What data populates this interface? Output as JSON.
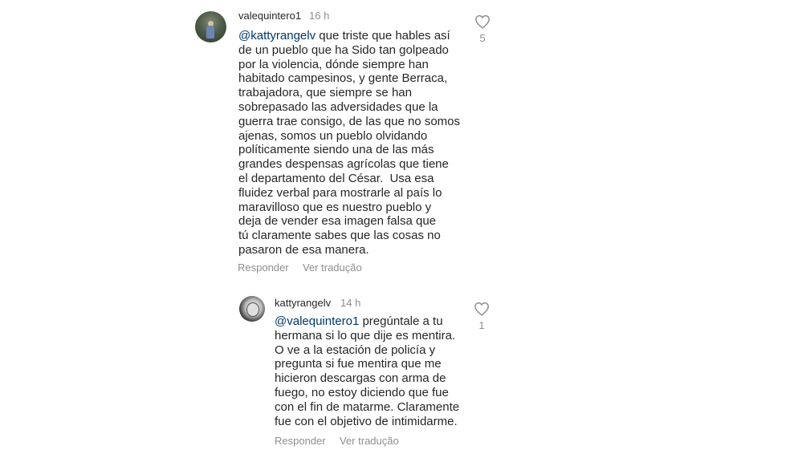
{
  "comments": [
    {
      "username": "valequintero1",
      "time": "16 h",
      "mention": "@kattyrangelv",
      "text": " que triste que hables así\nde un pueblo que ha Sido tan golpeado\npor la violencia, dónde siempre han\nhabitado campesinos, y gente Berraca,\ntrabajadora, que siempre se han\nsobrepasado las adversidades que la\nguerra trae consigo, de las que no somos\najenas, somos un pueblo olvidando\npolíticamente siendo una de las más\ngrandes despensas agrícolas que tiene\nel departamento del César.  Usa esa\nfluidez verbal para mostrarle al país lo\nmaravilloso que es nuestro pueblo y\ndeja de vender esa imagen falsa que\ntú claramente sabes que las cosas no\npasaron de esa manera.",
      "reply_label": "Responder",
      "translate_label": "Ver tradução",
      "likes": "5",
      "like_icon": "heart-outline-icon"
    },
    {
      "username": "kattyrangelv",
      "time": "14 h",
      "mention": "@valequintero1",
      "text": " pregúntale a tu\nhermana si lo que dije es mentira.\nO ve a la estación de policía y\npregunta si fue mentira que me\nhicieron descargas con arma de\nfuego, no estoy diciendo que fue\ncon el fin de matarme. Claramente\nfue con el objetivo de intimidarme.",
      "reply_label": "Responder",
      "translate_label": "Ver tradução",
      "likes": "1",
      "like_icon": "heart-outline-icon"
    }
  ]
}
